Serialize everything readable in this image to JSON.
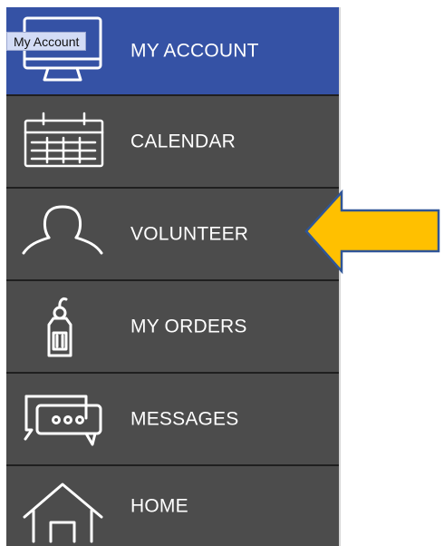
{
  "menu": {
    "items": [
      {
        "key": "account",
        "label": "MY ACCOUNT",
        "icon": "monitor-icon",
        "active": true
      },
      {
        "key": "calendar",
        "label": "CALENDAR",
        "icon": "calendar-icon",
        "active": false
      },
      {
        "key": "volunteer",
        "label": "VOLUNTEER",
        "icon": "person-icon",
        "active": false
      },
      {
        "key": "orders",
        "label": "MY ORDERS",
        "icon": "price-tag-icon",
        "active": false
      },
      {
        "key": "messages",
        "label": "MESSAGES",
        "icon": "chat-bubble-icon",
        "active": false
      },
      {
        "key": "home",
        "label": "HOME",
        "icon": "home-icon",
        "active": false
      }
    ]
  },
  "tooltip": {
    "text": "My Account"
  },
  "annotation": {
    "icon": "pointer-arrow-icon"
  },
  "colors": {
    "active_blue": "#3552a5",
    "menu_gray": "#4c4c4c",
    "separator": "#1f1f1f",
    "text_white": "#ffffff",
    "arrow_yellow": "#ffc000",
    "arrow_outline": "#2f5597"
  }
}
